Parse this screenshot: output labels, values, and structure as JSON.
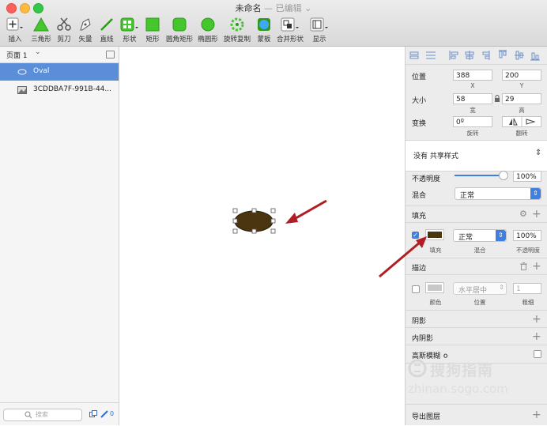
{
  "window": {
    "title": "未命名",
    "status": "— 已编辑",
    "status_caret": "⌄"
  },
  "toolbar": {
    "items": [
      {
        "label": "插入"
      },
      {
        "label": "三角形"
      },
      {
        "label": "剪刀"
      },
      {
        "label": "矢量"
      },
      {
        "label": "直线"
      },
      {
        "label": "形状"
      },
      {
        "label": "矩形"
      },
      {
        "label": "圆角矩形"
      },
      {
        "label": "椭圆形"
      },
      {
        "label": "旋转复制"
      },
      {
        "label": "蒙板"
      },
      {
        "label": "合并形状"
      },
      {
        "label": "显示"
      }
    ]
  },
  "sidebar": {
    "page_selector": "页面 1",
    "page_caret": "⌄",
    "layers": [
      {
        "name": "Oval",
        "icon": "oval-icon",
        "selected": true
      },
      {
        "name": "3CDDBA7F-991B-44...",
        "icon": "image-icon",
        "selected": false
      }
    ],
    "search_placeholder": "搜索",
    "badge_count": "0"
  },
  "inspector": {
    "position": {
      "label": "位置",
      "x": "388",
      "y": "200",
      "x_caption": "X",
      "y_caption": "Y"
    },
    "size": {
      "label": "大小",
      "width": "58",
      "height": "29",
      "w_caption": "宽",
      "h_caption": "高"
    },
    "transform": {
      "label": "变换",
      "rotation": "0º",
      "rotation_caption": "旋转",
      "flip_caption": "翻转"
    },
    "shared_style": "没有 共享样式",
    "opacity": {
      "label": "不透明度",
      "value": "100%",
      "slider": 1.0
    },
    "blend": {
      "label": "混合",
      "value": "正常"
    },
    "fill": {
      "title": "填充",
      "enabled": true,
      "color": "#4a3510",
      "blend": "正常",
      "opacity": "100%",
      "fill_caption": "填充",
      "blend_caption": "混合",
      "opacity_caption": "不透明度"
    },
    "border": {
      "title": "描边",
      "enabled": false,
      "color": "#c8c8c8",
      "position": "水平居中",
      "thickness": "1",
      "color_caption": "颜色",
      "position_caption": "位置",
      "thickness_caption": "粗细"
    },
    "shadow": {
      "title": "阴影"
    },
    "inner_shadow": {
      "title": "内阴影"
    },
    "blur": {
      "title": "高斯模糊 ≎"
    },
    "export": {
      "title": "导出图层"
    }
  },
  "canvas": {
    "oval_color": "#4a3510",
    "arrow_color": "#b01e24"
  },
  "watermark": {
    "text_cn": "搜狗指南",
    "text_en": "zhinan.sogo.com"
  }
}
